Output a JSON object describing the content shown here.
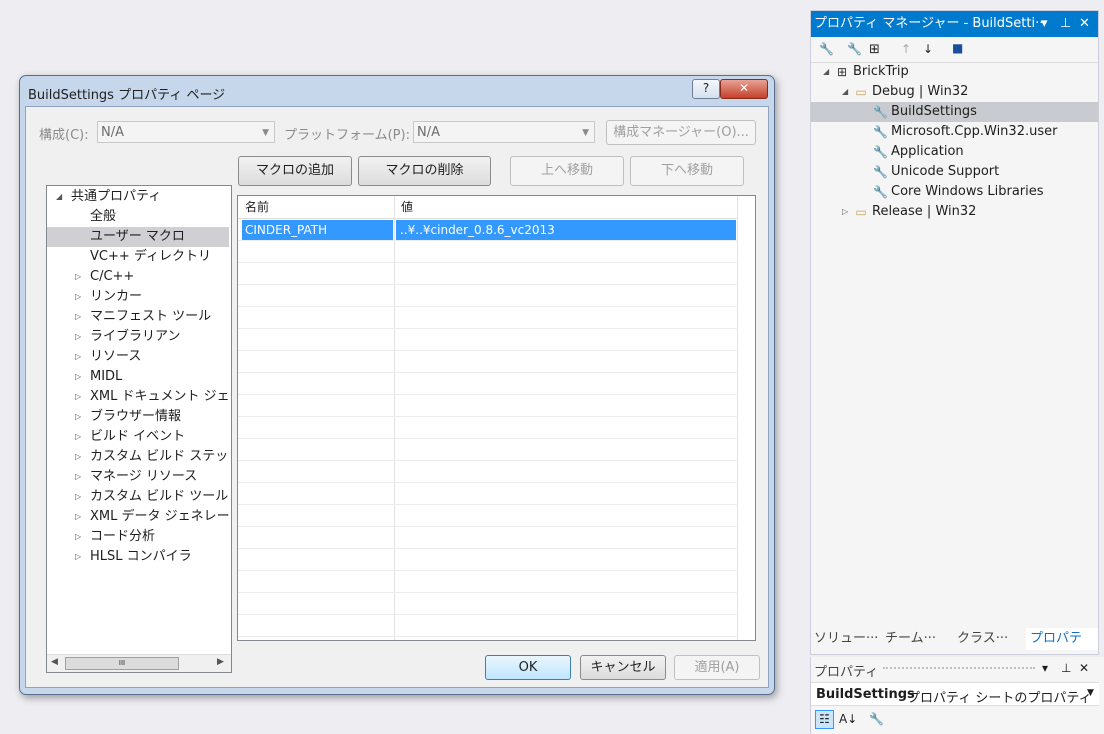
{
  "dialog": {
    "title": "BuildSettings プロパティ ページ",
    "help_label": "?",
    "close_label": "✕",
    "config_label": "構成(C):",
    "config_value": "N/A",
    "platform_label": "プラットフォーム(P):",
    "platform_value": "N/A",
    "config_manager_label": "構成マネージャー(O)...",
    "add_macro_label": "マクロの追加",
    "delete_macro_label": "マクロの削除",
    "move_up_label": "上へ移動",
    "move_down_label": "下へ移動",
    "ok_label": "OK",
    "cancel_label": "キャンセル",
    "apply_label": "適用(A)",
    "tree": [
      {
        "label": "共通プロパティ",
        "expander": "◢",
        "indent": 0
      },
      {
        "label": "全般",
        "expander": "",
        "indent": 1
      },
      {
        "label": "ユーザー マクロ",
        "expander": "",
        "indent": 1
      },
      {
        "label": "VC++ ディレクトリ",
        "expander": "",
        "indent": 1
      },
      {
        "label": "C/C++",
        "expander": "▷",
        "indent": 1
      },
      {
        "label": "リンカー",
        "expander": "▷",
        "indent": 1
      },
      {
        "label": "マニフェスト ツール",
        "expander": "▷",
        "indent": 1
      },
      {
        "label": "ライブラリアン",
        "expander": "▷",
        "indent": 1
      },
      {
        "label": "リソース",
        "expander": "▷",
        "indent": 1
      },
      {
        "label": "MIDL",
        "expander": "▷",
        "indent": 1
      },
      {
        "label": "XML ドキュメント ジェネ",
        "expander": "▷",
        "indent": 1
      },
      {
        "label": "ブラウザー情報",
        "expander": "▷",
        "indent": 1
      },
      {
        "label": "ビルド イベント",
        "expander": "▷",
        "indent": 1
      },
      {
        "label": "カスタム ビルド ステップ",
        "expander": "▷",
        "indent": 1
      },
      {
        "label": "マネージ リソース",
        "expander": "▷",
        "indent": 1
      },
      {
        "label": "カスタム ビルド ツール",
        "expander": "▷",
        "indent": 1
      },
      {
        "label": "XML データ ジェネレータ",
        "expander": "▷",
        "indent": 1
      },
      {
        "label": "コード分析",
        "expander": "▷",
        "indent": 1
      },
      {
        "label": "HLSL コンパイラ",
        "expander": "▷",
        "indent": 1
      }
    ],
    "tree_scroll_thumb_label": "III",
    "grid_headers": [
      "名前",
      "値"
    ],
    "grid_rows": [
      {
        "name": "CINDER_PATH",
        "value": "..¥..¥cinder_0.8.6_vc2013"
      }
    ]
  },
  "property_manager": {
    "title": "プロパティ マネージャー - BuildSetti···",
    "title_buttons": [
      "▾",
      "⊥",
      "✕"
    ],
    "tree": [
      {
        "label": "BrickTrip",
        "icon": "project-icon",
        "level": 0,
        "expander": "◢"
      },
      {
        "label": "Debug | Win32",
        "icon": "folder-icon",
        "level": 1,
        "expander": "◢"
      },
      {
        "label": "BuildSettings",
        "icon": "wrench-icon",
        "level": 2,
        "expander": ""
      },
      {
        "label": "Microsoft.Cpp.Win32.user",
        "icon": "wrench-icon",
        "level": 2,
        "expander": ""
      },
      {
        "label": "Application",
        "icon": "wrench-icon",
        "level": 2,
        "expander": ""
      },
      {
        "label": "Unicode Support",
        "icon": "wrench-icon",
        "level": 2,
        "expander": ""
      },
      {
        "label": "Core Windows Libraries",
        "icon": "wrench-icon",
        "level": 2,
        "expander": ""
      },
      {
        "label": "Release | Win32",
        "icon": "folder-icon",
        "level": 1,
        "expander": "▷"
      }
    ],
    "tabs": [
      "ソリュー···",
      "チーム···",
      "クラス···",
      "プロパテ···"
    ]
  },
  "properties": {
    "title": "プロパティ",
    "object_name": "BuildSettings",
    "object_desc": "プロパティ シートのプロパティ"
  },
  "colors": {
    "accent": "#007acc",
    "selection": "#3399ff"
  }
}
